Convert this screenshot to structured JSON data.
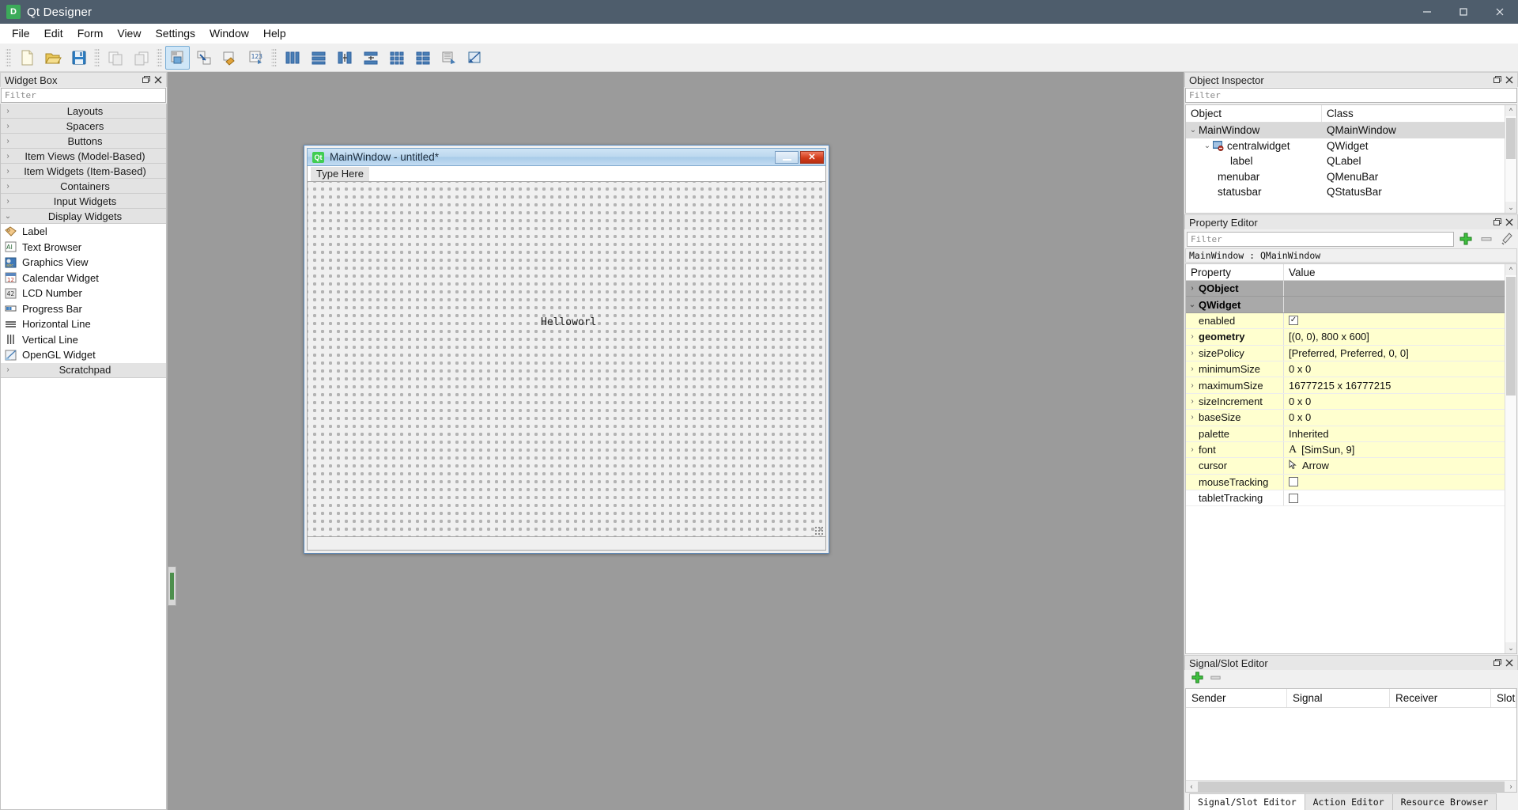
{
  "window": {
    "title": "Qt Designer",
    "app_icon": "D",
    "controls": {
      "minimize": "—",
      "maximize": "❐",
      "close": "✕"
    }
  },
  "menubar": {
    "items": [
      "File",
      "Edit",
      "Form",
      "View",
      "Settings",
      "Window",
      "Help"
    ]
  },
  "toolbar": {
    "groups": [
      {
        "name": "file",
        "buttons": [
          {
            "name": "new-form-button",
            "icon": "new-document-icon"
          },
          {
            "name": "open-form-button",
            "icon": "open-folder-icon"
          },
          {
            "name": "save-form-button",
            "icon": "floppy-save-icon"
          }
        ]
      },
      {
        "name": "edit",
        "buttons": [
          {
            "name": "undo-button",
            "icon": "undo-page-icon"
          },
          {
            "name": "redo-button",
            "icon": "redo-page-icon"
          }
        ]
      },
      {
        "name": "mode",
        "buttons": [
          {
            "name": "edit-widgets-button",
            "icon": "edit-widgets-icon",
            "active": true
          },
          {
            "name": "edit-signals-slots-button",
            "icon": "signals-slots-icon",
            "active": false
          },
          {
            "name": "edit-buddies-button",
            "icon": "buddies-icon",
            "active": false
          },
          {
            "name": "edit-tab-order-button",
            "icon": "tab-order-icon",
            "active": false
          }
        ]
      },
      {
        "name": "layout",
        "buttons": [
          {
            "name": "layout-horizontally-button",
            "icon": "layout-horizontal-icon"
          },
          {
            "name": "layout-vertically-button",
            "icon": "layout-vertical-icon"
          },
          {
            "name": "layout-splitter-horizontal-button",
            "icon": "splitter-horizontal-icon"
          },
          {
            "name": "layout-splitter-vertical-button",
            "icon": "splitter-vertical-icon"
          },
          {
            "name": "layout-grid-button",
            "icon": "layout-grid-icon"
          },
          {
            "name": "layout-form-button",
            "icon": "layout-form-icon"
          },
          {
            "name": "break-layout-button",
            "icon": "break-layout-icon"
          },
          {
            "name": "adjust-size-button",
            "icon": "adjust-size-icon"
          }
        ]
      }
    ]
  },
  "widget_box": {
    "title": "Widget Box",
    "filter_placeholder": "Filter",
    "categories": [
      {
        "label": "Layouts",
        "expanded": false,
        "items": []
      },
      {
        "label": "Spacers",
        "expanded": false,
        "items": []
      },
      {
        "label": "Buttons",
        "expanded": false,
        "items": []
      },
      {
        "label": "Item Views (Model-Based)",
        "expanded": false,
        "items": []
      },
      {
        "label": "Item Widgets (Item-Based)",
        "expanded": false,
        "items": []
      },
      {
        "label": "Containers",
        "expanded": false,
        "items": []
      },
      {
        "label": "Input Widgets",
        "expanded": false,
        "items": []
      },
      {
        "label": "Display Widgets",
        "expanded": true,
        "items": [
          {
            "label": "Label",
            "icon": "label-tag-icon"
          },
          {
            "label": "Text Browser",
            "icon": "text-browser-icon"
          },
          {
            "label": "Graphics View",
            "icon": "graphics-view-icon"
          },
          {
            "label": "Calendar Widget",
            "icon": "calendar-icon"
          },
          {
            "label": "LCD Number",
            "icon": "lcd-number-icon"
          },
          {
            "label": "Progress Bar",
            "icon": "progress-bar-icon"
          },
          {
            "label": "Horizontal Line",
            "icon": "horizontal-line-icon"
          },
          {
            "label": "Vertical Line",
            "icon": "vertical-line-icon"
          },
          {
            "label": "OpenGL Widget",
            "icon": "opengl-widget-icon"
          }
        ]
      },
      {
        "label": "Scratchpad",
        "expanded": false,
        "items": []
      }
    ],
    "dock_buttons": {
      "float": "❐",
      "close": "✕"
    }
  },
  "form": {
    "titlebar_text": "MainWindow - untitled*",
    "qt_badge": "Qt",
    "menu_placeholder": "Type Here",
    "label_text": "Helloworl",
    "buttons": {
      "minimize": "",
      "close": "✕"
    }
  },
  "object_inspector": {
    "title": "Object Inspector",
    "filter_placeholder": "Filter",
    "columns": [
      "Object",
      "Class"
    ],
    "rows": [
      {
        "object": "MainWindow",
        "class": "QMainWindow",
        "depth": 0,
        "arrow": "⌄",
        "selected": true,
        "icon": ""
      },
      {
        "object": "centralwidget",
        "class": "QWidget",
        "depth": 1,
        "arrow": "⌄",
        "selected": false,
        "icon": "central-widget-icon"
      },
      {
        "object": "label",
        "class": "QLabel",
        "depth": 2,
        "arrow": "",
        "selected": false,
        "icon": ""
      },
      {
        "object": "menubar",
        "class": "QMenuBar",
        "depth": 1,
        "arrow": "",
        "selected": false,
        "icon": ""
      },
      {
        "object": "statusbar",
        "class": "QStatusBar",
        "depth": 1,
        "arrow": "",
        "selected": false,
        "icon": ""
      }
    ],
    "dock_buttons": {
      "float": "❐",
      "close": "✕"
    }
  },
  "property_editor": {
    "title": "Property Editor",
    "filter_placeholder": "Filter",
    "object_line": "MainWindow : QMainWindow",
    "tool_buttons": [
      {
        "name": "add-dynamic-property-button",
        "icon": "plus-icon"
      },
      {
        "name": "remove-dynamic-property-button",
        "icon": "minus-icon"
      },
      {
        "name": "configure-property-editor-button",
        "icon": "wrench-icon"
      }
    ],
    "columns": [
      "Property",
      "Value"
    ],
    "rows": [
      {
        "name": "QObject",
        "value": "",
        "type": "group",
        "arrow": "›",
        "bold": true
      },
      {
        "name": "QWidget",
        "value": "",
        "type": "group",
        "arrow": "⌄",
        "bold": true
      },
      {
        "name": "enabled",
        "value": "",
        "type": "check",
        "arrow": "",
        "checked": true,
        "row": "yellow"
      },
      {
        "name": "geometry",
        "value": "[(0, 0), 800 x 600]",
        "type": "text",
        "arrow": "›",
        "bold": true,
        "row": "yellow"
      },
      {
        "name": "sizePolicy",
        "value": "[Preferred, Preferred, 0, 0]",
        "type": "text",
        "arrow": "›",
        "row": "yellow"
      },
      {
        "name": "minimumSize",
        "value": "0 x 0",
        "type": "text",
        "arrow": "›",
        "row": "yellow"
      },
      {
        "name": "maximumSize",
        "value": "16777215 x 16777215",
        "type": "text",
        "arrow": "›",
        "row": "yellow"
      },
      {
        "name": "sizeIncrement",
        "value": "0 x 0",
        "type": "text",
        "arrow": "›",
        "row": "yellow"
      },
      {
        "name": "baseSize",
        "value": "0 x 0",
        "type": "text",
        "arrow": "›",
        "row": "yellow"
      },
      {
        "name": "palette",
        "value": "Inherited",
        "type": "text",
        "arrow": "",
        "row": "yellow"
      },
      {
        "name": "font",
        "value": "[SimSun, 9]",
        "type": "font",
        "arrow": "›",
        "row": "yellow",
        "glyph": "A"
      },
      {
        "name": "cursor",
        "value": "Arrow",
        "type": "cursor",
        "arrow": "",
        "row": "yellow"
      },
      {
        "name": "mouseTracking",
        "value": "",
        "type": "check",
        "arrow": "",
        "checked": false,
        "row": "yellow"
      },
      {
        "name": "tabletTracking",
        "value": "",
        "type": "check",
        "arrow": "",
        "checked": false,
        "row": "white"
      }
    ],
    "dock_buttons": {
      "float": "❐",
      "close": "✕"
    }
  },
  "signal_slot_editor": {
    "title": "Signal/Slot Editor",
    "tool_buttons": [
      {
        "name": "add-connection-button",
        "icon": "plus-icon"
      },
      {
        "name": "remove-connection-button",
        "icon": "minus-icon"
      }
    ],
    "columns": [
      "Sender",
      "Signal",
      "Receiver",
      "Slot"
    ],
    "rows": [],
    "tabs": [
      {
        "label": "Signal/Slot Editor",
        "active": true
      },
      {
        "label": "Action Editor",
        "active": false
      },
      {
        "label": "Resource Browser",
        "active": false
      }
    ],
    "dock_buttons": {
      "float": "❐",
      "close": "✕"
    }
  },
  "colors": {
    "titlebar_bg": "#4e5d6c",
    "canvas_bg": "#9b9b9b",
    "panel_bg": "#f0f0f0",
    "property_row_highlight": "#ffffcf",
    "group_row": "#a9a9a9",
    "accent_green": "#41cd52",
    "toolbar_active": "#cfe6f7"
  }
}
